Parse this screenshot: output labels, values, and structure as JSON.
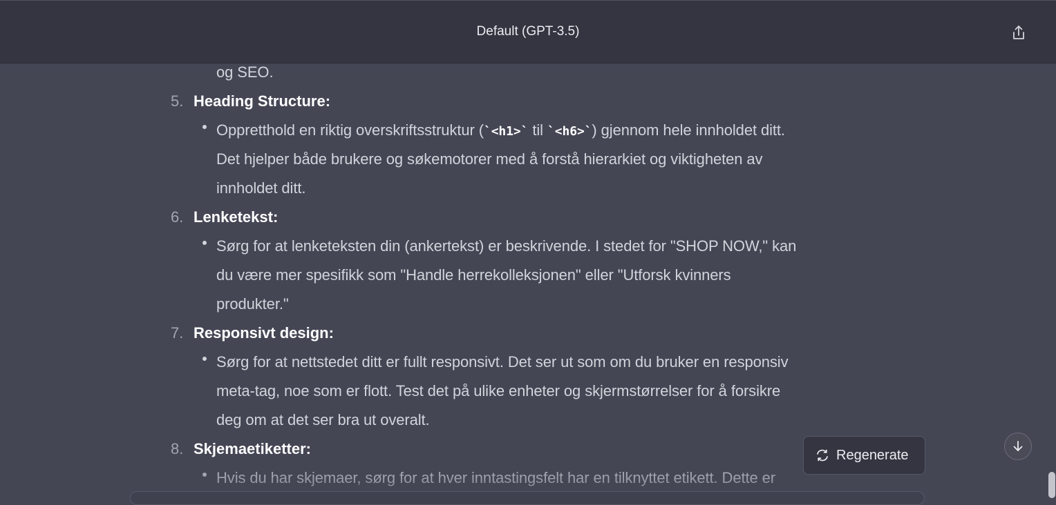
{
  "header": {
    "title": "Default (GPT-3.5)",
    "share_icon": "share-icon"
  },
  "conversation": {
    "prev_tail": "og SEO.",
    "items": [
      {
        "number": "5.",
        "heading": "Heading Structure:",
        "lines": [
          {
            "pre": "Oppretthold en riktig overskriftsstruktur (",
            "code1": "`<h1>`",
            "mid": " til ",
            "code2": "`<h6>`",
            "post": ") gjennom hele innholdet ditt."
          },
          "Det hjelper både brukere og søkemotorer med å forstå hierarkiet og viktigheten av",
          "innholdet ditt."
        ]
      },
      {
        "number": "6.",
        "heading": "Lenketekst:",
        "lines": [
          "Sørg for at lenketeksten din (ankertekst) er beskrivende. I stedet for \"SHOP NOW,\" kan",
          "du være mer spesifikk som \"Handle herrekolleksjonen\" eller \"Utforsk kvinners",
          "produkter.\""
        ]
      },
      {
        "number": "7.",
        "heading": "Responsivt design:",
        "lines": [
          "Sørg for at nettstedet ditt er fullt responsivt. Det ser ut som om du bruker en responsiv",
          "meta-tag, noe som er flott. Test det på ulike enheter og skjermstørrelser for å forsikre",
          "deg om at det ser bra ut overalt."
        ]
      },
      {
        "number": "8.",
        "heading": "Skjemaetiketter:",
        "lines": [
          "Hvis du har skjemaer, sørg for at hver inntastingsfelt har en tilknyttet etikett. Dette er"
        ]
      }
    ]
  },
  "controls": {
    "regenerate_label": "Regenerate",
    "regenerate_icon": "refresh-icon",
    "scroll_down_icon": "arrow-down-icon"
  },
  "colors": {
    "background": "#444654",
    "header_bg": "#343541",
    "text": "#d1d5db",
    "heading_text": "#ffffff"
  }
}
